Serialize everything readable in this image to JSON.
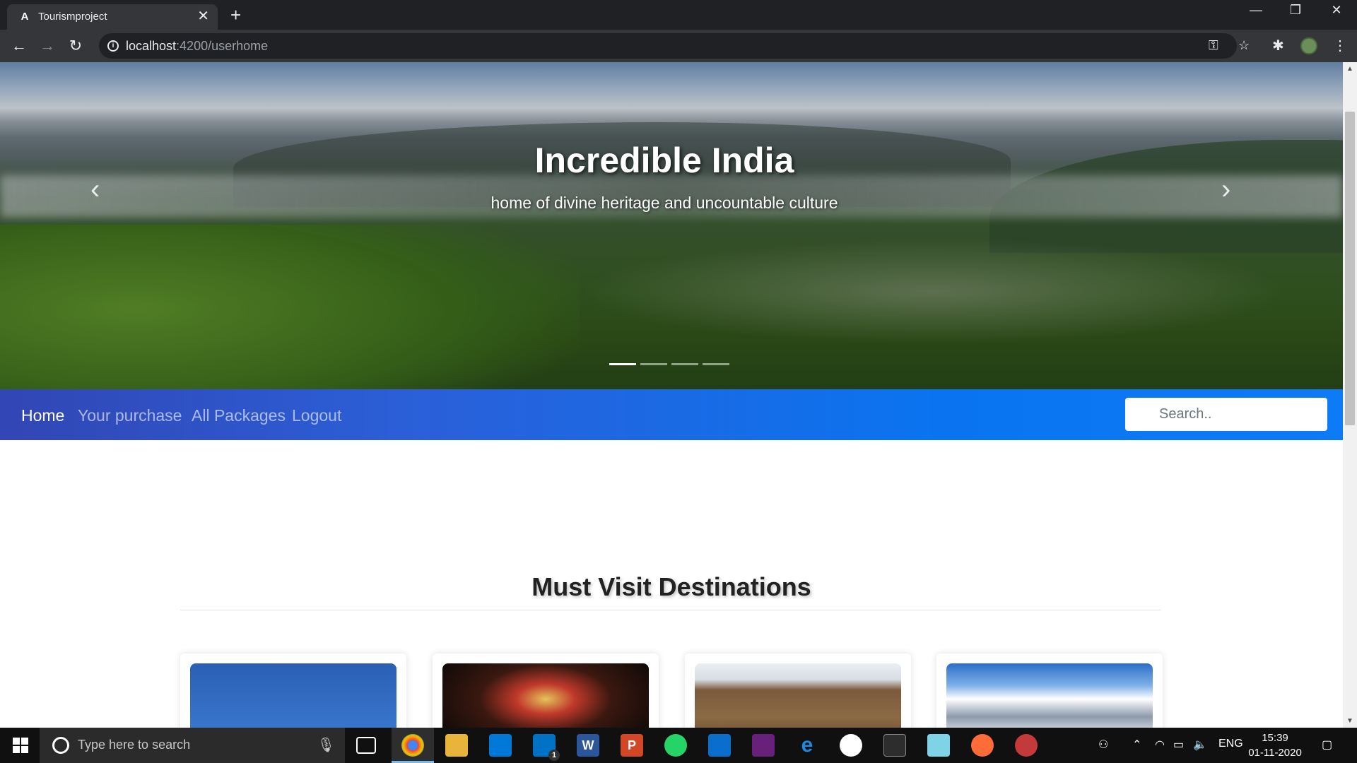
{
  "browser": {
    "tab_title": "Tourismproject",
    "tab_favicon": "A",
    "url_host": "localhost",
    "url_path": ":4200/userhome"
  },
  "hero": {
    "title": "Incredible India",
    "subtitle": "home of divine heritage and uncountable culture",
    "slide_count": 4,
    "active_slide": 1
  },
  "navbar": {
    "links": [
      "Home",
      "Your purchase",
      "All Packages",
      "Logout"
    ],
    "active": "Home",
    "search_placeholder": "Search.."
  },
  "section": {
    "title": "Must Visit Destinations"
  },
  "cards": [
    {
      "image": "blue-sky-photo"
    },
    {
      "image": "kathakali-dancer-photo"
    },
    {
      "image": "temple-ruins-photo"
    },
    {
      "image": "snow-mountains-photo"
    }
  ],
  "taskbar": {
    "search_placeholder": "Type here to search",
    "language": "ENG",
    "time": "15:39",
    "date": "01-11-2020",
    "mail_badge": "1"
  },
  "colors": {
    "navbar_start": "#3246b4",
    "navbar_end": "#0d7bf5",
    "chrome_dark": "#202124",
    "chrome_toolbar": "#35363a"
  }
}
